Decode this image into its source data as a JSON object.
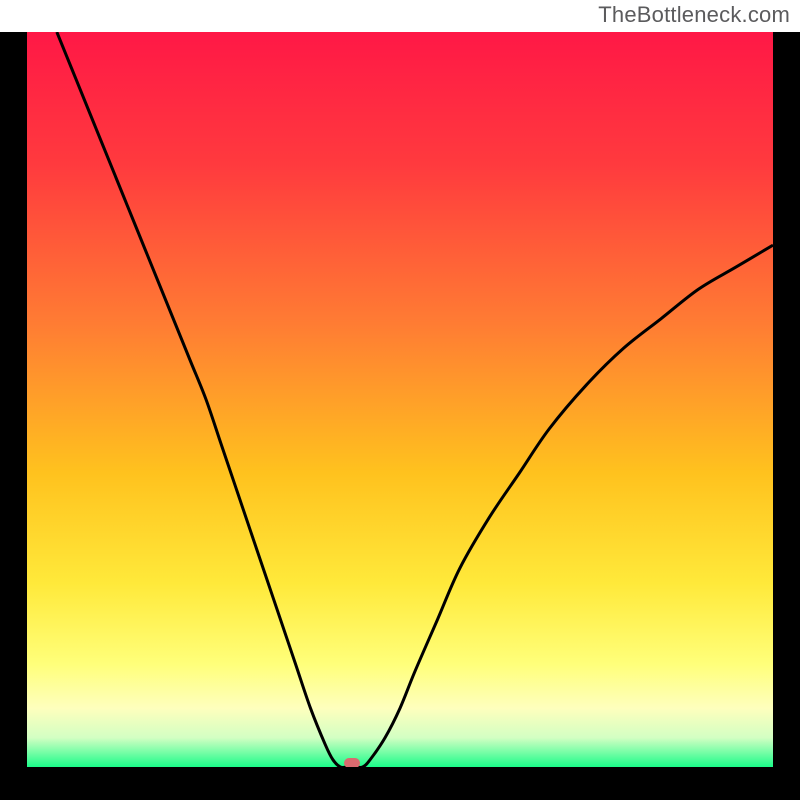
{
  "watermark": "TheBottleneck.com",
  "colors": {
    "frame": "#000000",
    "curve": "#000000",
    "marker": "#d96a6f",
    "gradient_stops": [
      {
        "pct": 0,
        "color": "#ff1846"
      },
      {
        "pct": 18,
        "color": "#ff3a3e"
      },
      {
        "pct": 40,
        "color": "#ff7d33"
      },
      {
        "pct": 60,
        "color": "#ffc21e"
      },
      {
        "pct": 75,
        "color": "#ffe93a"
      },
      {
        "pct": 86,
        "color": "#ffff7a"
      },
      {
        "pct": 92,
        "color": "#feffbd"
      },
      {
        "pct": 96,
        "color": "#d3ffc3"
      },
      {
        "pct": 100,
        "color": "#1bfc89"
      }
    ]
  },
  "chart_data": {
    "type": "line",
    "title": "",
    "xlabel": "",
    "ylabel": "",
    "x_range": [
      0,
      100
    ],
    "y_range": [
      0,
      100
    ],
    "legend": false,
    "grid": false,
    "series": [
      {
        "name": "bottleneck-curve",
        "x": [
          4,
          6,
          8,
          10,
          12,
          14,
          16,
          18,
          20,
          22,
          24,
          26,
          28,
          30,
          32,
          34,
          36,
          38,
          40,
          41,
          42,
          43,
          44,
          45,
          46,
          48,
          50,
          52,
          55,
          58,
          62,
          66,
          70,
          75,
          80,
          85,
          90,
          95,
          100
        ],
        "y": [
          100,
          95,
          90,
          85,
          80,
          75,
          70,
          65,
          60,
          55,
          50,
          44,
          38,
          32,
          26,
          20,
          14,
          8,
          3,
          1,
          0,
          0,
          0,
          0,
          1,
          4,
          8,
          13,
          20,
          27,
          34,
          40,
          46,
          52,
          57,
          61,
          65,
          68,
          71
        ]
      }
    ],
    "marker": {
      "x": 43.5,
      "y": 0.5
    },
    "annotations": []
  }
}
